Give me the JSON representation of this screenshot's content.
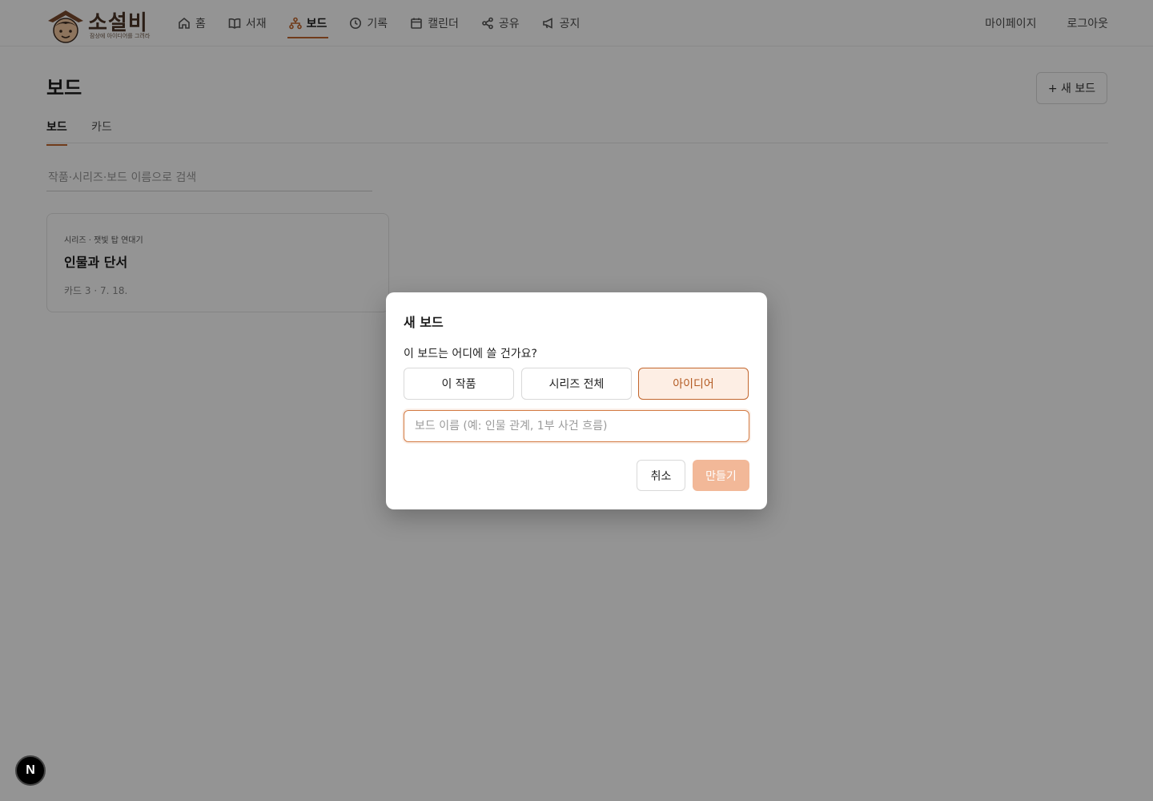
{
  "app": {
    "logo_text": "소설비",
    "logo_sub": "잠상에 아이디어를 그려라"
  },
  "nav": {
    "items": [
      {
        "label": "홈",
        "icon": "home-icon"
      },
      {
        "label": "서재",
        "icon": "book-icon"
      },
      {
        "label": "보드",
        "icon": "board-icon",
        "active": true
      },
      {
        "label": "기록",
        "icon": "clock-icon"
      },
      {
        "label": "캘린더",
        "icon": "calendar-icon"
      },
      {
        "label": "공유",
        "icon": "share-icon"
      },
      {
        "label": "공지",
        "icon": "megaphone-icon"
      }
    ],
    "mypage": "마이페이지",
    "logout": "로그아웃"
  },
  "page": {
    "title": "보드",
    "new_board_label": "+ 새 보드",
    "tabs": [
      "보드",
      "카드"
    ],
    "search_placeholder": "작품·시리즈·보드 이름으로 검색"
  },
  "cards": [
    {
      "meta": "시리즈 · 잿빛 탑 연대기",
      "title": "인물과 단서",
      "foot": "카드 3 · 7. 18."
    }
  ],
  "modal": {
    "title": "새 보드",
    "question": "이 보드는 어디에 쓸 건가요?",
    "options": [
      "이 작품",
      "시리즈 전체",
      "아이디어"
    ],
    "selected_option": "아이디어",
    "name_placeholder": "보드 이름 (예: 인물 관계, 1부 사건 흐름)",
    "name_value": "",
    "cancel": "취소",
    "create": "만들기"
  },
  "badge": {
    "label": "N"
  },
  "colors": {
    "accent": "#c2662d",
    "accent_light": "#fdeee4",
    "create_disabled": "#f2b898",
    "overlay": "rgba(0,0,0,0.42)"
  }
}
